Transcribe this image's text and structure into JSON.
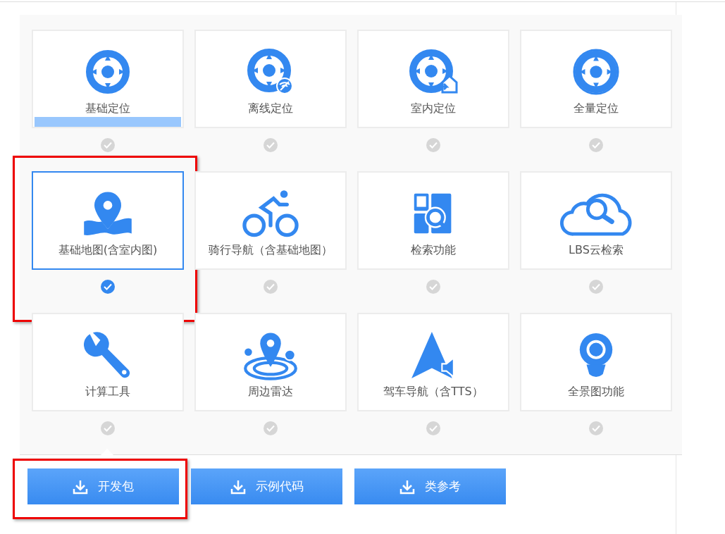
{
  "modules": [
    {
      "label": "基础定位",
      "kind": "locate",
      "selected": false,
      "hovered": true,
      "annotated": false
    },
    {
      "label": "离线定位",
      "kind": "offline-locate",
      "selected": false,
      "hovered": false,
      "annotated": false
    },
    {
      "label": "室内定位",
      "kind": "indoor-locate",
      "selected": false,
      "hovered": false,
      "annotated": false
    },
    {
      "label": "全量定位",
      "kind": "full-locate",
      "selected": false,
      "hovered": false,
      "annotated": false
    },
    {
      "label": "基础地图(含室内图)",
      "kind": "map",
      "selected": true,
      "hovered": false,
      "annotated": true
    },
    {
      "label": "骑行导航（含基础地图）",
      "kind": "bike",
      "selected": false,
      "hovered": false,
      "annotated": false
    },
    {
      "label": "检索功能",
      "kind": "search",
      "selected": false,
      "hovered": false,
      "annotated": false
    },
    {
      "label": "LBS云检索",
      "kind": "cloud-search",
      "selected": false,
      "hovered": false,
      "annotated": false
    },
    {
      "label": "计算工具",
      "kind": "tool",
      "selected": false,
      "hovered": false,
      "annotated": false
    },
    {
      "label": "周边雷达",
      "kind": "radar",
      "selected": false,
      "hovered": false,
      "annotated": false
    },
    {
      "label": "驾车导航（含TTS）",
      "kind": "navigation",
      "selected": false,
      "hovered": false,
      "annotated": false
    },
    {
      "label": "全景图功能",
      "kind": "panorama",
      "selected": false,
      "hovered": false,
      "annotated": false
    }
  ],
  "buttons": [
    {
      "label": "开发包",
      "annotated": true
    },
    {
      "label": "示例代码",
      "annotated": false
    },
    {
      "label": "类参考",
      "annotated": false
    }
  ]
}
